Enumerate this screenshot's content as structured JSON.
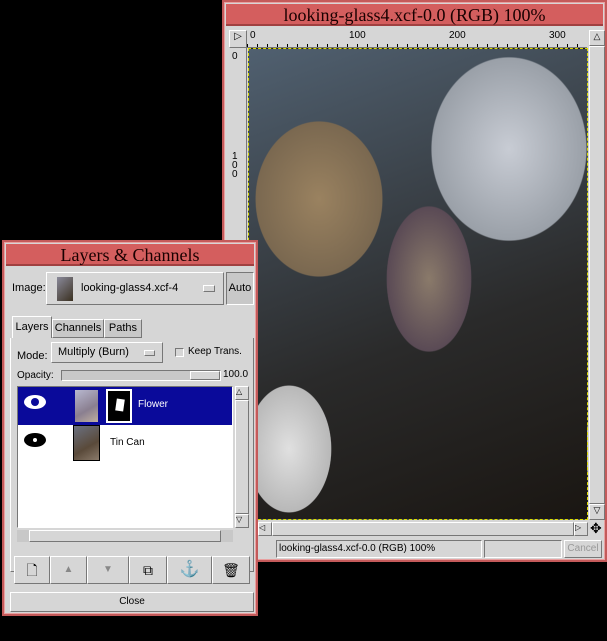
{
  "image_window": {
    "title": "looking-glass4.xcf-0.0 (RGB) 100%",
    "ruler_h": [
      "0",
      "100",
      "200",
      "300"
    ],
    "ruler_v": [
      "0",
      "100"
    ],
    "status": "looking-glass4.xcf-0.0 (RGB) 100%",
    "cancel_label": "Cancel"
  },
  "layers_dialog": {
    "title": "Layers & Channels",
    "image_label": "Image:",
    "image_value": "looking-glass4.xcf-4",
    "auto_label": "Auto",
    "tabs": [
      "Layers",
      "Channels",
      "Paths"
    ],
    "mode_label": "Mode:",
    "mode_value": "Multiply (Burn)",
    "keep_trans_label": "Keep Trans.",
    "keep_trans_checked": false,
    "opacity_label": "Opacity:",
    "opacity_value": "100.0",
    "layers": [
      {
        "name": "Flower",
        "visible": true,
        "selected": true,
        "has_mask": true
      },
      {
        "name": "Tin Can",
        "visible": true,
        "selected": false,
        "has_mask": false
      }
    ],
    "buttons": [
      "new-layer",
      "raise-layer",
      "lower-layer",
      "duplicate-layer",
      "anchor-layer",
      "delete-layer"
    ],
    "close_label": "Close",
    "selection_color": "#0a0a9a",
    "title_color": "#d45e5e"
  }
}
